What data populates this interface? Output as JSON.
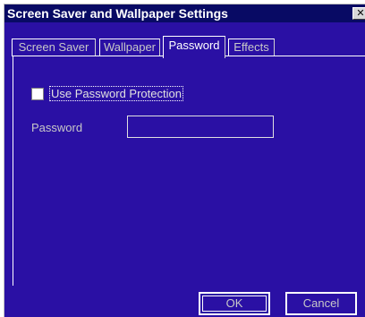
{
  "window": {
    "title": "Screen Saver and Wallpaper Settings",
    "close_glyph": "✕"
  },
  "tabs": [
    {
      "label": "Screen Saver",
      "active": false
    },
    {
      "label": "Wallpaper",
      "active": false
    },
    {
      "label": "Password",
      "active": true
    },
    {
      "label": "Effects",
      "active": false
    }
  ],
  "password_tab": {
    "use_password_label": "Use Password Protection",
    "use_password_checked": false,
    "password_label": "Password",
    "password_value": ""
  },
  "buttons": {
    "ok_label": "OK",
    "cancel_label": "Cancel"
  },
  "colors": {
    "window_bg": "#2a10a4",
    "titlebar_bg": "#080a64",
    "border": "#ffffff"
  }
}
